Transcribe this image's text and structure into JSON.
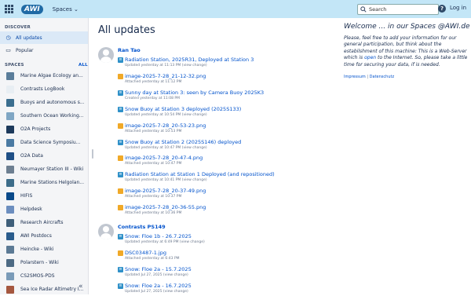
{
  "topbar": {
    "logo": "AWI",
    "spaces_menu": "Spaces",
    "search_placeholder": "Search",
    "help": "?",
    "login": "Log in"
  },
  "sidebar": {
    "discover_label": "DISCOVER",
    "nav": [
      {
        "label": "All updates"
      },
      {
        "label": "Popular"
      }
    ],
    "spaces_label": "SPACES",
    "all_label": "ALL",
    "spaces": [
      {
        "label": "Marine Algae Ecology an...",
        "color": "#5a7d9a"
      },
      {
        "label": "Contrasts LogBook",
        "color": "#e8eef3"
      },
      {
        "label": "Buoys and autonomous s...",
        "color": "#3b6e8f"
      },
      {
        "label": "Southern Ocean Working...",
        "color": "#7fa6c4"
      },
      {
        "label": "O2A Projects",
        "color": "#1d3a5c"
      },
      {
        "label": "Data Science Symposiu...",
        "color": "#4a7aa3"
      },
      {
        "label": "O2A Data",
        "color": "#1f4f86"
      },
      {
        "label": "Neumayer Station III - Wiki",
        "color": "#6d7f91"
      },
      {
        "label": "Marine Stations Helgolan...",
        "color": "#3d6d8a"
      },
      {
        "label": "HIFIS",
        "color": "#0a4a8a"
      },
      {
        "label": "Helpdesk",
        "color": "#6c8ebf"
      },
      {
        "label": "Research Aircrafts",
        "color": "#3f5f7a"
      },
      {
        "label": "AWI Postdocs",
        "color": "#2a5c8c"
      },
      {
        "label": "Heincke - Wiki",
        "color": "#5c7a95"
      },
      {
        "label": "Polarstern - Wiki",
        "color": "#4d6a84"
      },
      {
        "label": "CS2SMOS-PDS",
        "color": "#7a9bb8"
      },
      {
        "label": "Sea Ice Radar Altimetry I...",
        "color": "#a5573f"
      }
    ],
    "collapse": "«"
  },
  "main": {
    "title": "All updates",
    "groups": [
      {
        "space": "Ran Tao",
        "items": [
          {
            "kind": "page",
            "title": "Radiation Station, 2025R31, Deployed at Station 3",
            "meta": "Updated yesterday at 11:13 PM (view change)"
          },
          {
            "kind": "img",
            "title": "image-2025-7-28_21-12-32.png",
            "meta": "Attached yesterday at 11:12 PM"
          },
          {
            "kind": "page",
            "title": "Sunny day at Station 3: seen by Camera Buoy 2025K3",
            "meta": "Created yesterday at 11:08 PM"
          },
          {
            "kind": "page",
            "title": "Snow Buoy at Station 3 deployed (2025S133)",
            "meta": "Updated yesterday at 10:54 PM (view change)"
          },
          {
            "kind": "img",
            "title": "image-2025-7-28_20-53-23.png",
            "meta": "Attached yesterday at 10:53 PM"
          },
          {
            "kind": "page",
            "title": "Snow Buoy at Station 2 (2025S146) deployed",
            "meta": "Updated yesterday at 10:47 PM (view change)"
          },
          {
            "kind": "img",
            "title": "image-2025-7-28_20-47-4.png",
            "meta": "Attached yesterday at 10:47 PM"
          },
          {
            "kind": "page",
            "title": "Radiation Station at Station 1 Deployed (and repositioned)",
            "meta": "Updated yesterday at 10:41 PM (view change)"
          },
          {
            "kind": "img",
            "title": "image-2025-7-28_20-37-49.png",
            "meta": "Attached yesterday at 10:37 PM"
          },
          {
            "kind": "img",
            "title": "image-2025-7-28_20-36-55.png",
            "meta": "Attached yesterday at 10:36 PM"
          }
        ]
      },
      {
        "space": "Contrasts PS149",
        "items": [
          {
            "kind": "page",
            "title": "Snow: Floe 1b - 26.7.2025",
            "meta": "Updated yesterday at 6:49 PM (view change)"
          },
          {
            "kind": "img",
            "title": "DSC03487-1.jpg",
            "meta": "Attached yesterday at 6:43 PM"
          },
          {
            "kind": "page",
            "title": "Snow: Floe 2a - 15.7.2025",
            "meta": "Updated Jul 27, 2025 (view change)"
          },
          {
            "kind": "page",
            "title": "Snow: Floe 2a - 16.7.2025",
            "meta": "Updated Jul 27, 2025 (view change)"
          }
        ]
      }
    ]
  },
  "welcome": {
    "title": "Welcome ... in our Spaces @AWI.de",
    "text_before": "Please, feel free to add your information for our general participation, but think about the estabilshment of this machine: This is a Web-Server which is ",
    "text_link": "open",
    "text_after": " to the Internet. So, please take a little time for securing your data, if is needed.",
    "impressum": "Impressum",
    "separator": " | ",
    "datenschutz": "Datenschutz"
  }
}
